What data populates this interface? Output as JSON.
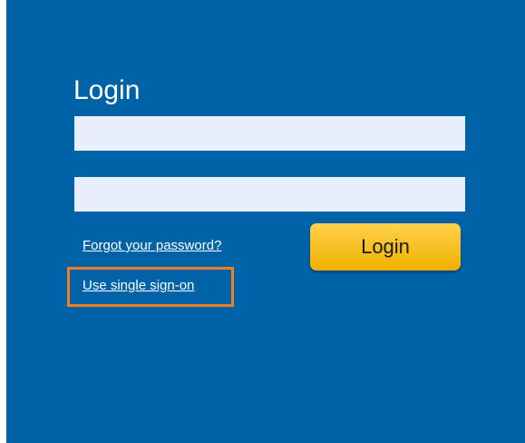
{
  "login": {
    "title": "Login",
    "username": {
      "value": "",
      "placeholder": ""
    },
    "password": {
      "value": "",
      "placeholder": ""
    },
    "forgot_password_link": "Forgot your password?",
    "sso_link": "Use single sign-on",
    "login_button": "Login"
  },
  "colors": {
    "panel_background": "#0063a8",
    "input_background": "#e8eefb",
    "button_gradient_top": "#ffd24a",
    "button_gradient_bottom": "#f0b000",
    "highlight_border": "#f07f24",
    "text": "#ffffff"
  }
}
